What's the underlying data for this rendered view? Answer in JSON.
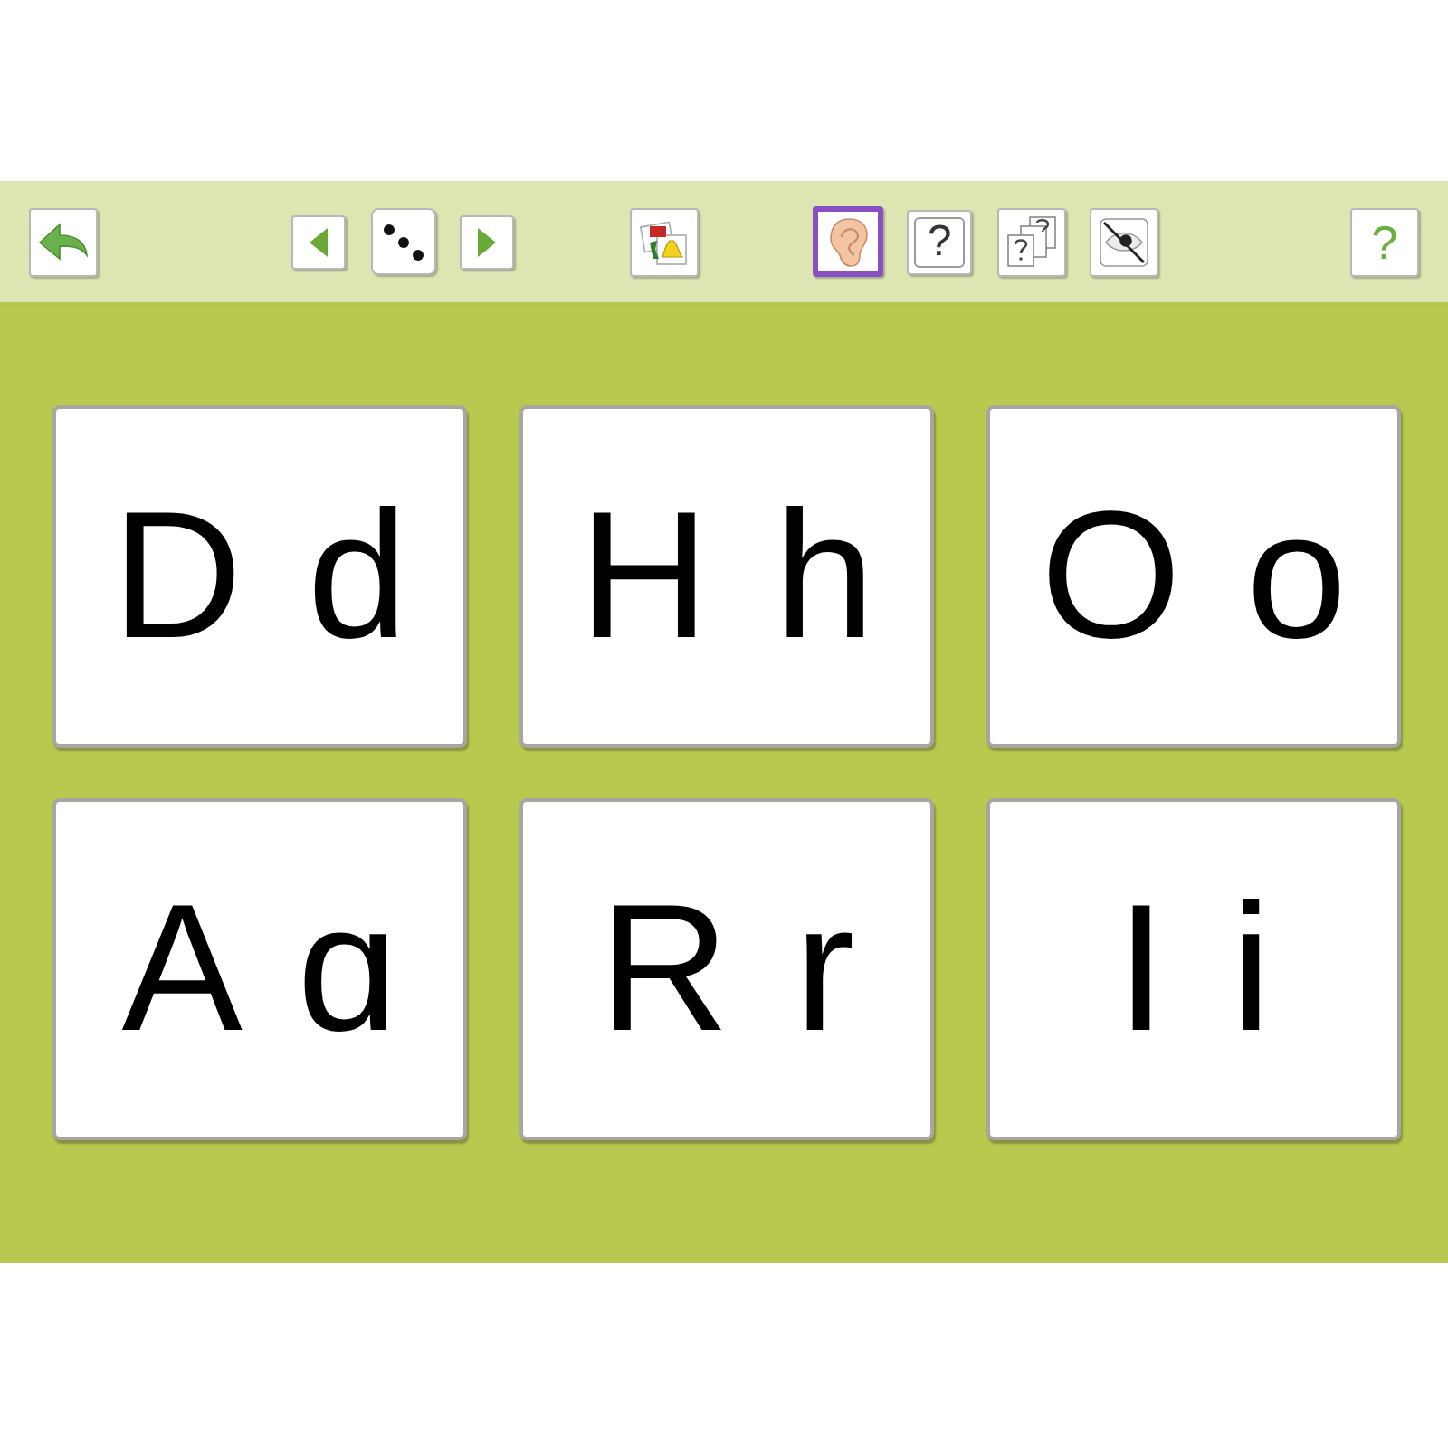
{
  "toolbar": {
    "tools": [
      {
        "kind": "pictures",
        "selected": false
      },
      {
        "kind": "listen",
        "selected": true
      },
      {
        "kind": "question",
        "label": "?",
        "selected": false
      },
      {
        "kind": "questions",
        "selected": false
      },
      {
        "kind": "hide",
        "selected": false
      }
    ],
    "help": {
      "label": "?"
    }
  },
  "cards": [
    {
      "text": "D d"
    },
    {
      "text": "H h"
    },
    {
      "text": "O o"
    },
    {
      "text": "A ɑ"
    },
    {
      "text": "R r"
    },
    {
      "text": "I i"
    }
  ]
}
